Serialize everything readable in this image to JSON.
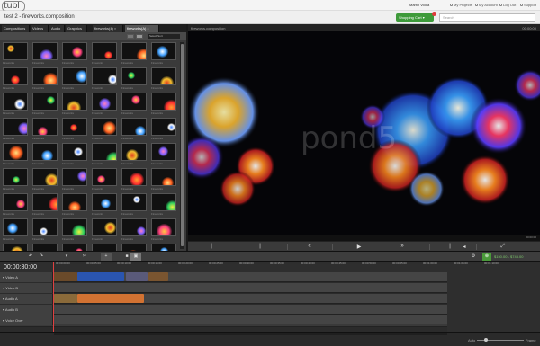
{
  "header": {
    "logo": "tubl",
    "user_name": "Martin Volda",
    "links": [
      "My Projects",
      "My Account",
      "Log Out",
      "Support"
    ]
  },
  "project": {
    "title": "test 2 - fireworks.composition",
    "cart_label": "Shopping Cart",
    "search_placeholder": "Search"
  },
  "library": {
    "tabs": [
      {
        "label": "Compositions"
      },
      {
        "label": "Videos"
      },
      {
        "label": "Audio"
      },
      {
        "label": "Graphics"
      },
      {
        "label": "fireworks(4)"
      },
      {
        "label": "fireworks(A)"
      }
    ],
    "sort_label": "Select Sort",
    "thumb_label": "Fireworks"
  },
  "preview": {
    "title": "fireworks.composition",
    "right": "00:00:00",
    "timecode": "00:00:00",
    "watermark": "pond5"
  },
  "timeline": {
    "current_time": "00:00:30:00",
    "price_text": "$150.00 - $745.00",
    "ruler_labels": [
      "00:00:00:00",
      "00:00:05:00",
      "00:00:10:00",
      "00:00:15:00",
      "00:00:20:00",
      "00:00:25:00",
      "00:00:30:00",
      "00:00:35:00",
      "00:00:40:00",
      "00:00:45:00",
      "00:00:50:00",
      "00:00:55:00",
      "00:01:00:00",
      "00:01:05:00",
      "00:01:10:00"
    ],
    "tracks": [
      {
        "label": "Video A"
      },
      {
        "label": "Video B"
      },
      {
        "label": "Audio A"
      },
      {
        "label": "Audio B"
      },
      {
        "label": "Voice Over"
      }
    ],
    "zoom_left": "Auto",
    "zoom_right": "Frame"
  },
  "colors": {
    "accent_green": "#3e9a3a",
    "clip_blue": "#2a55b0",
    "clip_orange": "#d27232",
    "playhead": "#e04040"
  }
}
